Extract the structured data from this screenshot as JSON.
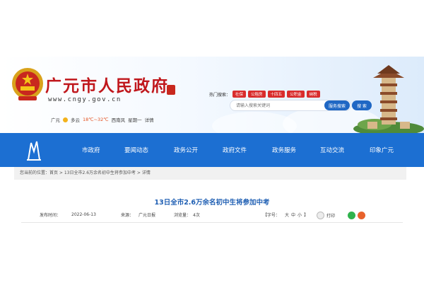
{
  "header": {
    "site_title": "广元市人民政府",
    "site_url": "www.cngy.gov.cn",
    "weather": {
      "city": "广元",
      "condition": "多云",
      "temp": "18℃~32℃",
      "wind": "西南风",
      "weekday": "星期一",
      "detail": "详情"
    }
  },
  "hot_search": {
    "label": "热门搜索：",
    "tags": [
      "社保",
      "公租房",
      "十四五",
      "公积金",
      "纳税"
    ]
  },
  "search": {
    "placeholder": "请输入搜索关键词",
    "service_label": "服务搜索",
    "search_label": "搜 索"
  },
  "nav": {
    "items": [
      "市政府",
      "要闻动态",
      "政务公开",
      "政府文件",
      "政务服务",
      "互动交流",
      "印象广元"
    ]
  },
  "breadcrumb": {
    "text": "您当前的位置：首页 > 13日全市2.6万余名初中生将参加中考 > 详情"
  },
  "article": {
    "title": "13日全市2.6万余名初中生将参加中考",
    "publish_label": "发布时间：",
    "publish_date": "2022-06-13",
    "source_label": "来源：",
    "source": "广元日报",
    "views_label": "浏览量：",
    "views": "4次",
    "font_size_label": "【字号：",
    "size_large": "大",
    "size_medium": "中",
    "size_small": "小",
    "font_size_end": "】",
    "print_label": "打印"
  },
  "colors": {
    "brand_red": "#c0171c",
    "nav_blue": "#1c6fd2",
    "title_blue": "#1f5fb3"
  }
}
